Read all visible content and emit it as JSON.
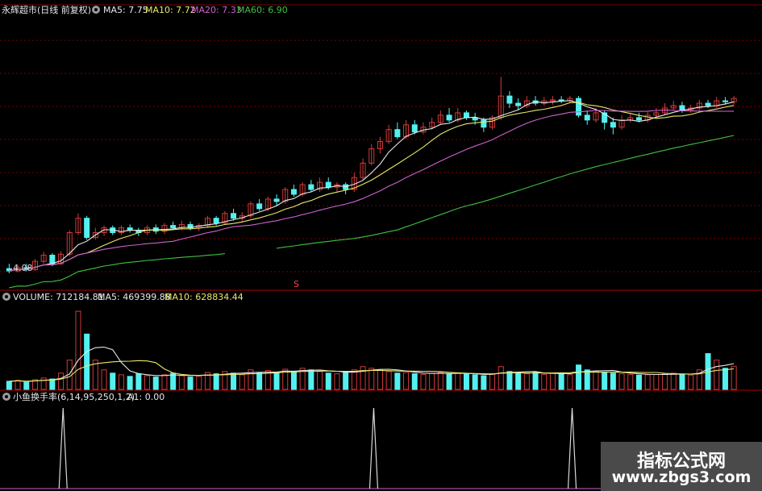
{
  "colors": {
    "background": "#000000",
    "grid": "#7a0000",
    "up": "#d23a3a",
    "down": "#54f0f0",
    "ma5": "#e8e8e8",
    "ma10": "#e8e86a",
    "ma20": "#d060d0",
    "ma60": "#40c040",
    "a1": "#d8d8d8"
  },
  "icons": {
    "panel_toggle": "circle-dot-icon"
  },
  "price_panel": {
    "name": "永辉超市(日线 前复权)",
    "ma5_label": "MA5: 7.75",
    "ma10_label": "MA10: 7.72",
    "ma20_label": "MA20: 7.33",
    "ma60_label": "MA60: 6.90",
    "low_label": "4.08",
    "marker": "S"
  },
  "volume_panel": {
    "title": "VOLUME: 712184.81",
    "ma5_label": "MA5: 469399.88",
    "ma10_label": "MA10: 628834.44"
  },
  "indicator_panel": {
    "title": "小鱼换手率(6,14,95,250,1,2)",
    "a1_label": "A1: 0.00"
  },
  "watermark": {
    "title": "指标公式网",
    "url": "www.zbgs3.com"
  },
  "chart_data": [
    {
      "type": "candlestick",
      "title": "永辉超市(日线 前复权)",
      "ylim": [
        4.0,
        9.4
      ],
      "low_marker": 4.08,
      "series": [
        {
          "name": "MA5",
          "last": 7.75
        },
        {
          "name": "MA10",
          "last": 7.72
        },
        {
          "name": "MA20",
          "last": 7.33
        },
        {
          "name": "MA60",
          "last": 6.9
        }
      ],
      "candles": [
        [
          4.2,
          4.15,
          4.3,
          4.1
        ],
        [
          4.15,
          4.22,
          4.28,
          4.12
        ],
        [
          4.22,
          4.18,
          4.3,
          4.14
        ],
        [
          4.18,
          4.35,
          4.4,
          4.15
        ],
        [
          4.35,
          4.48,
          4.55,
          4.3
        ],
        [
          4.48,
          4.3,
          4.52,
          4.25
        ],
        [
          4.3,
          4.5,
          4.56,
          4.28
        ],
        [
          4.5,
          4.95,
          5.0,
          4.45
        ],
        [
          4.95,
          5.25,
          5.35,
          4.9
        ],
        [
          5.25,
          4.85,
          5.3,
          4.8
        ],
        [
          4.85,
          4.95,
          5.05,
          4.8
        ],
        [
          4.95,
          5.05,
          5.1,
          4.88
        ],
        [
          5.05,
          4.95,
          5.1,
          4.9
        ],
        [
          4.95,
          5.05,
          5.1,
          4.9
        ],
        [
          5.05,
          5.0,
          5.12,
          4.95
        ],
        [
          5.0,
          4.95,
          5.05,
          4.88
        ],
        [
          4.95,
          5.05,
          5.1,
          4.9
        ],
        [
          5.05,
          4.98,
          5.12,
          4.92
        ],
        [
          4.98,
          5.1,
          5.15,
          4.92
        ],
        [
          5.1,
          5.05,
          5.18,
          5.0
        ],
        [
          5.05,
          5.12,
          5.2,
          5.0
        ],
        [
          5.12,
          5.05,
          5.18,
          5.0
        ],
        [
          5.05,
          5.1,
          5.15,
          4.98
        ],
        [
          5.1,
          5.25,
          5.3,
          5.05
        ],
        [
          5.25,
          5.15,
          5.3,
          5.1
        ],
        [
          5.15,
          5.35,
          5.4,
          5.12
        ],
        [
          5.35,
          5.25,
          5.45,
          5.2
        ],
        [
          5.25,
          5.3,
          5.38,
          5.18
        ],
        [
          5.3,
          5.55,
          5.6,
          5.25
        ],
        [
          5.55,
          5.45,
          5.65,
          5.4
        ],
        [
          5.45,
          5.65,
          5.7,
          5.4
        ],
        [
          5.65,
          5.6,
          5.75,
          5.5
        ],
        [
          5.6,
          5.85,
          5.9,
          5.55
        ],
        [
          5.85,
          5.75,
          5.95,
          5.7
        ],
        [
          5.75,
          5.95,
          6.0,
          5.7
        ],
        [
          5.95,
          5.85,
          6.05,
          5.8
        ],
        [
          5.85,
          6.0,
          6.1,
          5.8
        ],
        [
          6.0,
          5.9,
          6.1,
          5.85
        ],
        [
          5.9,
          5.95,
          6.0,
          5.8
        ],
        [
          5.95,
          5.85,
          6.0,
          5.75
        ],
        [
          5.85,
          6.1,
          6.2,
          5.8
        ],
        [
          6.1,
          6.4,
          6.5,
          6.05
        ],
        [
          6.4,
          6.7,
          6.8,
          6.35
        ],
        [
          6.7,
          6.85,
          6.95,
          6.6
        ],
        [
          6.85,
          7.1,
          7.2,
          6.8
        ],
        [
          7.1,
          6.95,
          7.25,
          6.9
        ],
        [
          6.95,
          7.2,
          7.3,
          6.9
        ],
        [
          7.2,
          7.05,
          7.3,
          7.0
        ],
        [
          7.05,
          7.15,
          7.25,
          7.0
        ],
        [
          7.15,
          7.25,
          7.35,
          7.1
        ],
        [
          7.25,
          7.4,
          7.5,
          7.2
        ],
        [
          7.4,
          7.3,
          7.55,
          7.25
        ],
        [
          7.3,
          7.45,
          7.55,
          7.25
        ],
        [
          7.45,
          7.35,
          7.5,
          7.3
        ],
        [
          7.35,
          7.3,
          7.45,
          7.2
        ],
        [
          7.3,
          7.15,
          7.35,
          7.05
        ],
        [
          7.15,
          7.35,
          7.4,
          7.1
        ],
        [
          7.35,
          7.8,
          8.2,
          7.3
        ],
        [
          7.8,
          7.65,
          7.9,
          7.55
        ],
        [
          7.65,
          7.6,
          7.75,
          7.5
        ],
        [
          7.6,
          7.7,
          7.8,
          7.55
        ],
        [
          7.7,
          7.65,
          7.8,
          7.6
        ],
        [
          7.65,
          7.7,
          7.78,
          7.6
        ],
        [
          7.7,
          7.72,
          7.8,
          7.62
        ],
        [
          7.72,
          7.7,
          7.8,
          7.65
        ],
        [
          7.7,
          7.75,
          7.8,
          7.65
        ],
        [
          7.75,
          7.4,
          7.8,
          7.35
        ],
        [
          7.4,
          7.3,
          7.5,
          7.2
        ],
        [
          7.3,
          7.45,
          7.55,
          7.25
        ],
        [
          7.45,
          7.25,
          7.5,
          7.1
        ],
        [
          7.25,
          7.15,
          7.35,
          7.0
        ],
        [
          7.15,
          7.3,
          7.4,
          7.1
        ],
        [
          7.3,
          7.35,
          7.45,
          7.25
        ],
        [
          7.35,
          7.3,
          7.45,
          7.25
        ],
        [
          7.3,
          7.4,
          7.48,
          7.25
        ],
        [
          7.4,
          7.45,
          7.55,
          7.35
        ],
        [
          7.45,
          7.55,
          7.65,
          7.4
        ],
        [
          7.55,
          7.6,
          7.7,
          7.5
        ],
        [
          7.6,
          7.5,
          7.68,
          7.45
        ],
        [
          7.5,
          7.55,
          7.62,
          7.45
        ],
        [
          7.55,
          7.65,
          7.72,
          7.5
        ],
        [
          7.65,
          7.6,
          7.72,
          7.55
        ],
        [
          7.6,
          7.7,
          7.78,
          7.55
        ],
        [
          7.7,
          7.68,
          7.78,
          7.62
        ],
        [
          7.68,
          7.75,
          7.8,
          7.62
        ]
      ]
    },
    {
      "type": "bar",
      "title": "VOLUME: 712184.81",
      "series": [
        {
          "name": "MA5",
          "last": 469399.88
        },
        {
          "name": "MA10",
          "last": 628834.44
        }
      ],
      "ylim": [
        0,
        2600000
      ],
      "values": [
        250000,
        280000,
        220000,
        300000,
        350000,
        320000,
        500000,
        900000,
        2400000,
        1700000,
        900000,
        600000,
        500000,
        450000,
        400000,
        480000,
        420000,
        380000,
        450000,
        500000,
        420000,
        380000,
        400000,
        520000,
        480000,
        550000,
        500000,
        450000,
        600000,
        520000,
        580000,
        500000,
        620000,
        560000,
        650000,
        600000,
        550000,
        500000,
        480000,
        520000,
        600000,
        700000,
        650000,
        600000,
        550000,
        500000,
        520000,
        480000,
        460000,
        500000,
        520000,
        480000,
        500000,
        470000,
        450000,
        420000,
        480000,
        700000,
        550000,
        500000,
        480000,
        520000,
        460000,
        500000,
        480000,
        450000,
        750000,
        600000,
        550000,
        520000,
        500000,
        480000,
        460000,
        440000,
        450000,
        460000,
        480000,
        500000,
        470000,
        440000,
        600000,
        1100000,
        900000,
        650000,
        712184.81
      ]
    },
    {
      "type": "line",
      "title": "小鱼换手率(6,14,95,250,1,2)",
      "series": [
        {
          "name": "A1",
          "last": 0.0
        }
      ],
      "spikes_at_bar": [
        7,
        43,
        66
      ],
      "ylim": [
        0,
        1
      ]
    }
  ]
}
